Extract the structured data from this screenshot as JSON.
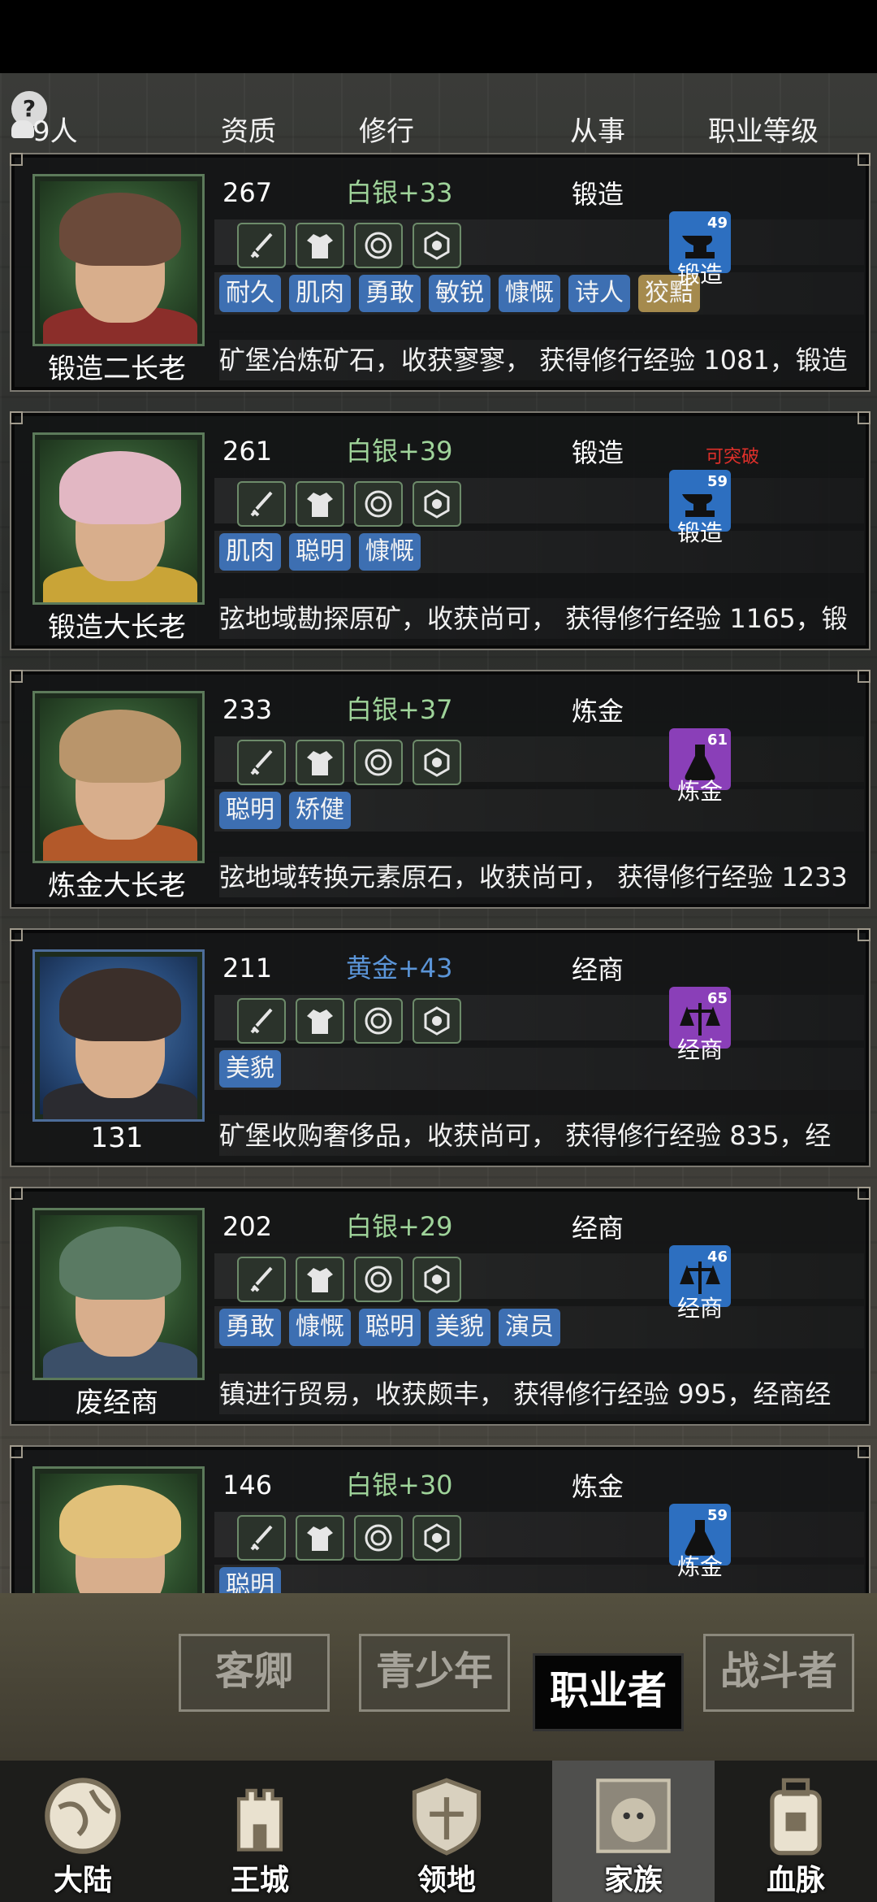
{
  "header": {
    "count": "9人",
    "col_quality": "资质",
    "col_cultivation": "修行",
    "col_occupation": "从事",
    "col_job_level": "职业等级"
  },
  "members": [
    {
      "name": "锻造二长老",
      "quality": "267",
      "grade": "白银+33",
      "grade_color": "#9fd49a",
      "job": "锻造",
      "breakthrough": "",
      "badge_level": "49",
      "badge_label": "锻造",
      "badge_color": "blue",
      "traits": [
        "耐久",
        "肌肉",
        "勇敢",
        "敏锐",
        "慷慨",
        "诗人",
        "狡黠"
      ],
      "log": "矿堡冶炼矿石，收获寥寥， 获得修行经验 1081，锻造"
    },
    {
      "name": "锻造大长老",
      "quality": "261",
      "grade": "白银+39",
      "grade_color": "#9fd49a",
      "job": "锻造",
      "breakthrough": "可突破",
      "badge_level": "59",
      "badge_label": "锻造",
      "badge_color": "blue",
      "traits": [
        "肌肉",
        "聪明",
        "慷慨"
      ],
      "log": "弦地域勘探原矿，收获尚可， 获得修行经验 1165，锻"
    },
    {
      "name": "炼金大长老",
      "quality": "233",
      "grade": "白银+37",
      "grade_color": "#9fd49a",
      "job": "炼金",
      "breakthrough": "",
      "badge_level": "61",
      "badge_label": "炼金",
      "badge_color": "purple",
      "traits": [
        "聪明",
        "矫健"
      ],
      "log": "弦地域转换元素原石，收获尚可， 获得修行经验 1233"
    },
    {
      "name": "131",
      "quality": "211",
      "grade": "黄金+43",
      "grade_color": "#5b95d8",
      "job": "经商",
      "breakthrough": "",
      "badge_level": "65",
      "badge_label": "经商",
      "badge_color": "purple",
      "traits": [
        "美貌"
      ],
      "log": "矿堡收购奢侈品，收获尚可， 获得修行经验 835，经"
    },
    {
      "name": "废经商",
      "quality": "202",
      "grade": "白银+29",
      "grade_color": "#9fd49a",
      "job": "经商",
      "breakthrough": "",
      "badge_level": "46",
      "badge_label": "经商",
      "badge_color": "blue",
      "traits": [
        "勇敢",
        "慷慨",
        "聪明",
        "美貌",
        "演员"
      ],
      "log": "镇进行贸易，收获颇丰， 获得修行经验 995，经商经"
    },
    {
      "name": "",
      "quality": "146",
      "grade": "白银+30",
      "grade_color": "#9fd49a",
      "job": "炼金",
      "breakthrough": "",
      "badge_level": "59",
      "badge_label": "炼金",
      "badge_color": "blue",
      "traits": [
        "聪明"
      ],
      "log": ""
    }
  ],
  "filter_tabs": [
    "客卿",
    "青少年",
    "职业者",
    "战斗者"
  ],
  "active_filter": "职业者",
  "nav": [
    "大陆",
    "王城",
    "领地",
    "家族",
    "血脉"
  ],
  "active_nav": "家族",
  "colors": {
    "tag_blue": "#3d6fb2",
    "tag_gold": "#a58a4d",
    "badge_blue": "#2d6fc0",
    "badge_purple": "#8a3fb8",
    "breakthrough_red": "#e0302a"
  }
}
